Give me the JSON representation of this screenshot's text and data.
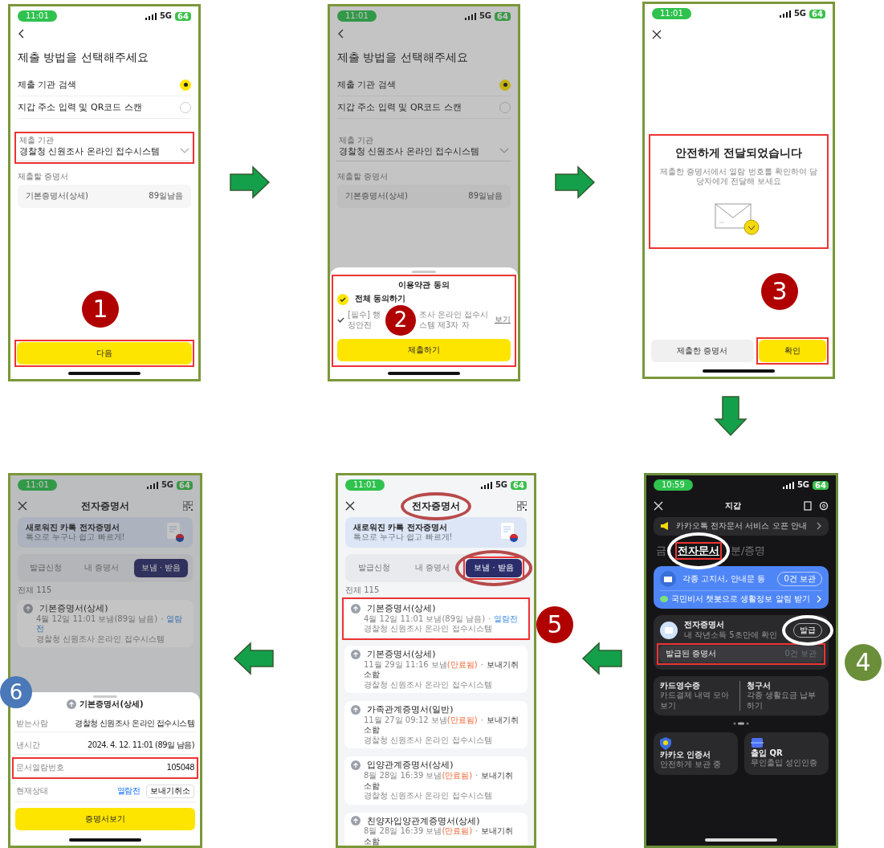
{
  "panels": [
    {
      "kind": "submit",
      "status": {
        "time": "11:01",
        "network": "5G",
        "battery": "64"
      },
      "title": "제출 방법을 선택해주세요",
      "options": [
        {
          "label": "제출 기관 검색",
          "selected": true
        },
        {
          "label": "지갑 주소 입력 및 QR코드 스캔",
          "selected": false
        }
      ],
      "field": {
        "label": "제출 기관",
        "value": "경찰청 신원조사 온라인 접수시스템",
        "boxed": true
      },
      "cert_label": "제출할 증명서",
      "cert": {
        "name": "기본증명서(상세)",
        "remaining": "89일남음"
      },
      "button": {
        "label": "다음",
        "boxed": true
      },
      "step": {
        "number": "1",
        "color": "#b00000"
      }
    },
    {
      "kind": "submit",
      "dimmed": true,
      "status": {
        "time": "11:01",
        "network": "5G",
        "battery": "64"
      },
      "title": "제출 방법을 선택해주세요",
      "options": [
        {
          "label": "제출 기관 검색",
          "selected": true
        },
        {
          "label": "지갑 주소 입력 및 QR코드 스캔",
          "selected": false
        }
      ],
      "field": {
        "label": "제출 기관",
        "value": "경찰청 신원조사 온라인 접수시스템",
        "boxed": false
      },
      "cert_label": "제출할 증명서",
      "cert": {
        "name": "기본증명서(상세)",
        "remaining": "89일남음"
      },
      "sheet": {
        "title": "이용약관 동의",
        "agree_all": {
          "label": "전체 동의하기",
          "checked": true
        },
        "terms": {
          "start": "[필수] 행정안전",
          "end": "조사 온라인 접수시스템 제3자 자",
          "link": "보기",
          "checked": true
        },
        "button": "제출하기",
        "boxed": true
      },
      "step": {
        "number": "2",
        "color": "#b00000"
      }
    },
    {
      "kind": "done",
      "status": {
        "time": "11:01",
        "network": "5G",
        "battery": "64"
      },
      "message": {
        "title": "안전하게 전달되었습니다",
        "body": "제출한 증명서에서 열람 번호를 확인하여 담당자에게 전달해 보세요",
        "boxed": true
      },
      "buttons": [
        {
          "label": "제출한 증명서",
          "kind": "secondary",
          "boxed": false
        },
        {
          "label": "확인",
          "kind": "primary",
          "boxed": true
        }
      ],
      "step": {
        "number": "3",
        "color": "#b00000"
      }
    },
    {
      "kind": "certs",
      "dimmed": true,
      "status": {
        "time": "11:01",
        "network": "5G",
        "battery": "64"
      },
      "title": "전자증명서",
      "banner": {
        "title": "새로워진 카톡 전자증명서",
        "subtitle": "톡으로 누구나 쉽고 빠르게!"
      },
      "tabs": [
        {
          "label": "발급신청",
          "selected": false,
          "boxed": false,
          "circled": false
        },
        {
          "label": "내 증명서",
          "selected": false,
          "boxed": false,
          "circled": false
        },
        {
          "label": "보냄 · 받음",
          "selected": true,
          "boxed": false,
          "circled": false
        }
      ],
      "total": "전체 115",
      "items": [
        {
          "name": "기본증명서(상세)",
          "date": "4월 12일 11:01 보냄(89일 남음)",
          "separator": "·",
          "status": "열람전",
          "kind": "unread",
          "org": "경찰청 신원조사 온라인 접수시스템",
          "boxed": false
        }
      ],
      "sheet": {
        "title": "기본증명서(상세)",
        "rows": [
          {
            "label": "받는사람",
            "value": "경찰청 신원조사 온라인 접수시스템",
            "boxed": false
          },
          {
            "label": "낸시간",
            "value": "2024. 4. 12. 11:01 (89일 남음)",
            "boxed": false
          },
          {
            "label": "문서열람번호",
            "value": "105048",
            "boxed": true
          },
          {
            "label": "현재상태",
            "value": "열람전",
            "action": "보내기취소",
            "boxed": false
          }
        ],
        "button": "증명서보기"
      },
      "step": {
        "number": "6",
        "color": "#4a78b8"
      }
    },
    {
      "kind": "certs",
      "status": {
        "time": "11:01",
        "network": "5G",
        "battery": "64"
      },
      "title": "전자증명서",
      "title_circled": true,
      "banner": {
        "title": "새로워진 카톡 전자증명서",
        "subtitle": "톡으로 누구나 쉽고 빠르게!"
      },
      "tabs": [
        {
          "label": "발급신청",
          "selected": false,
          "boxed": false,
          "circled": false
        },
        {
          "label": "내 증명서",
          "selected": false,
          "boxed": false,
          "circled": false
        },
        {
          "label": "보냄 · 받음",
          "selected": true,
          "boxed": true,
          "circled": true
        }
      ],
      "total": "전체 115",
      "items": [
        {
          "name": "기본증명서(상세)",
          "date": "4월 12일 11:01 보냄(89일 남음)",
          "separator": "·",
          "status": "열람전",
          "kind": "unread",
          "org": "경찰청 신원조사 온라인 접수시스템",
          "boxed": true
        },
        {
          "name": "기본증명서(상세)",
          "date": "11월 29일 11:16 보냄",
          "flag": "(만료됨)",
          "separator": "·",
          "status": "보내기취소함",
          "kind": "cancelled",
          "org": "경찰청 신원조사 온라인 접수시스템",
          "boxed": false
        },
        {
          "name": "가족관계증명서(일반)",
          "date": "11월 27일 09:12 보냄",
          "flag": "(만료됨)",
          "separator": "·",
          "status": "보내기취소함",
          "kind": "cancelled",
          "org": "경찰청 신원조사 온라인 접수시스템",
          "boxed": false
        },
        {
          "name": "입양관계증명서(상세)",
          "date": "8월 28일 16:39 보냄",
          "flag": "(만료됨)",
          "separator": "·",
          "status": "보내기취소함",
          "kind": "cancelled",
          "org": "경찰청 신원조사 온라인 접수시스템",
          "boxed": false
        },
        {
          "name": "친양자입양관계증명서(상세)",
          "date": "8월 28일 16:39 보냄",
          "flag": "(만료됨)",
          "separator": "·",
          "status": "보내기취소함",
          "kind": "cancelled",
          "boxed": false
        }
      ],
      "step": {
        "number": "5",
        "color": "#b00000"
      }
    },
    {
      "kind": "wallet",
      "status": {
        "time": "10:59",
        "network": "5G",
        "battery": "64"
      },
      "title": "지갑",
      "notice": "카카오톡 전자문서 서비스 오픈 안내",
      "tabs": [
        {
          "label": "금",
          "selected": false,
          "boxed": false,
          "circled": false
        },
        {
          "label": "전자문서",
          "selected": true,
          "boxed": true,
          "circled": true
        },
        {
          "label": "분/증명",
          "selected": false,
          "boxed": false,
          "circled": false
        }
      ],
      "doc_card": {
        "subtitle": "각종 고지서, 안내문 등",
        "count": "0건 보관",
        "promo": "국민비서 챗봇으로 생활정보 알림 받기"
      },
      "cert_card": {
        "title": "전자증명서",
        "subtitle": "내 작년소득 5초만에 확인",
        "button": "발급",
        "button_circled": true,
        "issued": {
          "label": "발급된 증명서",
          "count": "0건 보관",
          "boxed": true
        }
      },
      "services": [
        {
          "title": "카드영수증",
          "subtitle": "카드결제 내역 모아보기"
        },
        {
          "title": "청구서",
          "subtitle": "각종 생활요금 납부하기"
        }
      ],
      "tiles": [
        {
          "title": "카카오 인증서",
          "subtitle": "안전하게 보관 중",
          "kind": "shield"
        },
        {
          "title": "출입 QR",
          "subtitle": "무인출입 성인인증",
          "kind": "qr"
        }
      ],
      "step": {
        "number": "4",
        "color": "#6b8e3a"
      }
    }
  ],
  "arrows": [
    {
      "kind": "right"
    },
    {
      "kind": "right"
    },
    {
      "kind": "down"
    },
    {
      "kind": "left"
    },
    {
      "kind": "left"
    }
  ]
}
